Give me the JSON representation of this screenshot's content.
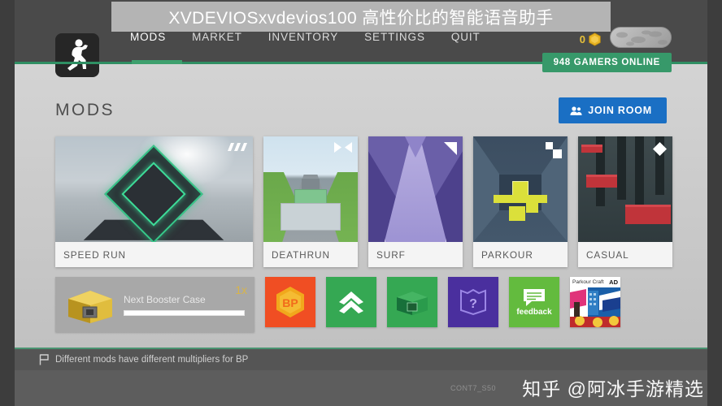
{
  "overlay_title": "XVDEVIOSxvdevios100 高性价比的智能语音助手",
  "header": {
    "avatar_icon": "running-figure-icon",
    "nav": [
      {
        "label": "MODS",
        "active": true
      },
      {
        "label": "MARKET",
        "active": false
      },
      {
        "label": "INVENTORY",
        "active": false
      },
      {
        "label": "SETTINGS",
        "active": false
      },
      {
        "label": "QUIT",
        "active": false
      }
    ],
    "coin_count": "0",
    "coin_icon": "gold-coin-icon",
    "online_badge": "948 GAMERS ONLINE",
    "accent_green": "#37996a",
    "header_bg": "#4a4a4a"
  },
  "page": {
    "title": "MODS",
    "join_room_label": "JOIN ROOM",
    "join_room_icon": "users-icon",
    "join_room_color": "#1a6fc4"
  },
  "mods": [
    {
      "name": "SPEED RUN",
      "badge_icon": "speed-lines-icon"
    },
    {
      "name": "DEATHRUN",
      "badge_icon": "bowtie-icon"
    },
    {
      "name": "SURF",
      "badge_icon": "triangle-flag-icon"
    },
    {
      "name": "PARKOUR",
      "badge_icon": "two-squares-icon"
    },
    {
      "name": "CASUAL",
      "badge_icon": "diamond-icon"
    }
  ],
  "booster": {
    "label": "Next Booster Case",
    "multiplier": "1x",
    "progress_percent": 0,
    "icon": "gold-crate-icon"
  },
  "tiles": [
    {
      "name": "bp-tile",
      "icon": "bp-hexagon-icon",
      "label": "BP",
      "color": "#f04e23"
    },
    {
      "name": "upgrade-tile",
      "icon": "double-chevron-up-icon",
      "label": "",
      "color": "#35a853"
    },
    {
      "name": "case-tile",
      "icon": "green-crate-icon",
      "label": "",
      "color": "#35a853"
    },
    {
      "name": "quests-tile",
      "icon": "question-shield-icon",
      "label": "?",
      "color": "#4a2f9e"
    },
    {
      "name": "feedback-tile",
      "icon": "speech-bubble-icon",
      "label": "feedback",
      "color": "#63bb3e"
    }
  ],
  "ad": {
    "title": "Parkour Craft",
    "tag": "AD"
  },
  "footer": {
    "hint_icon": "flag-icon",
    "hint": "Different mods have different multipliers for BP",
    "small_code": "CONT7_S50",
    "watermark": "知乎 @阿冰手游精选"
  }
}
